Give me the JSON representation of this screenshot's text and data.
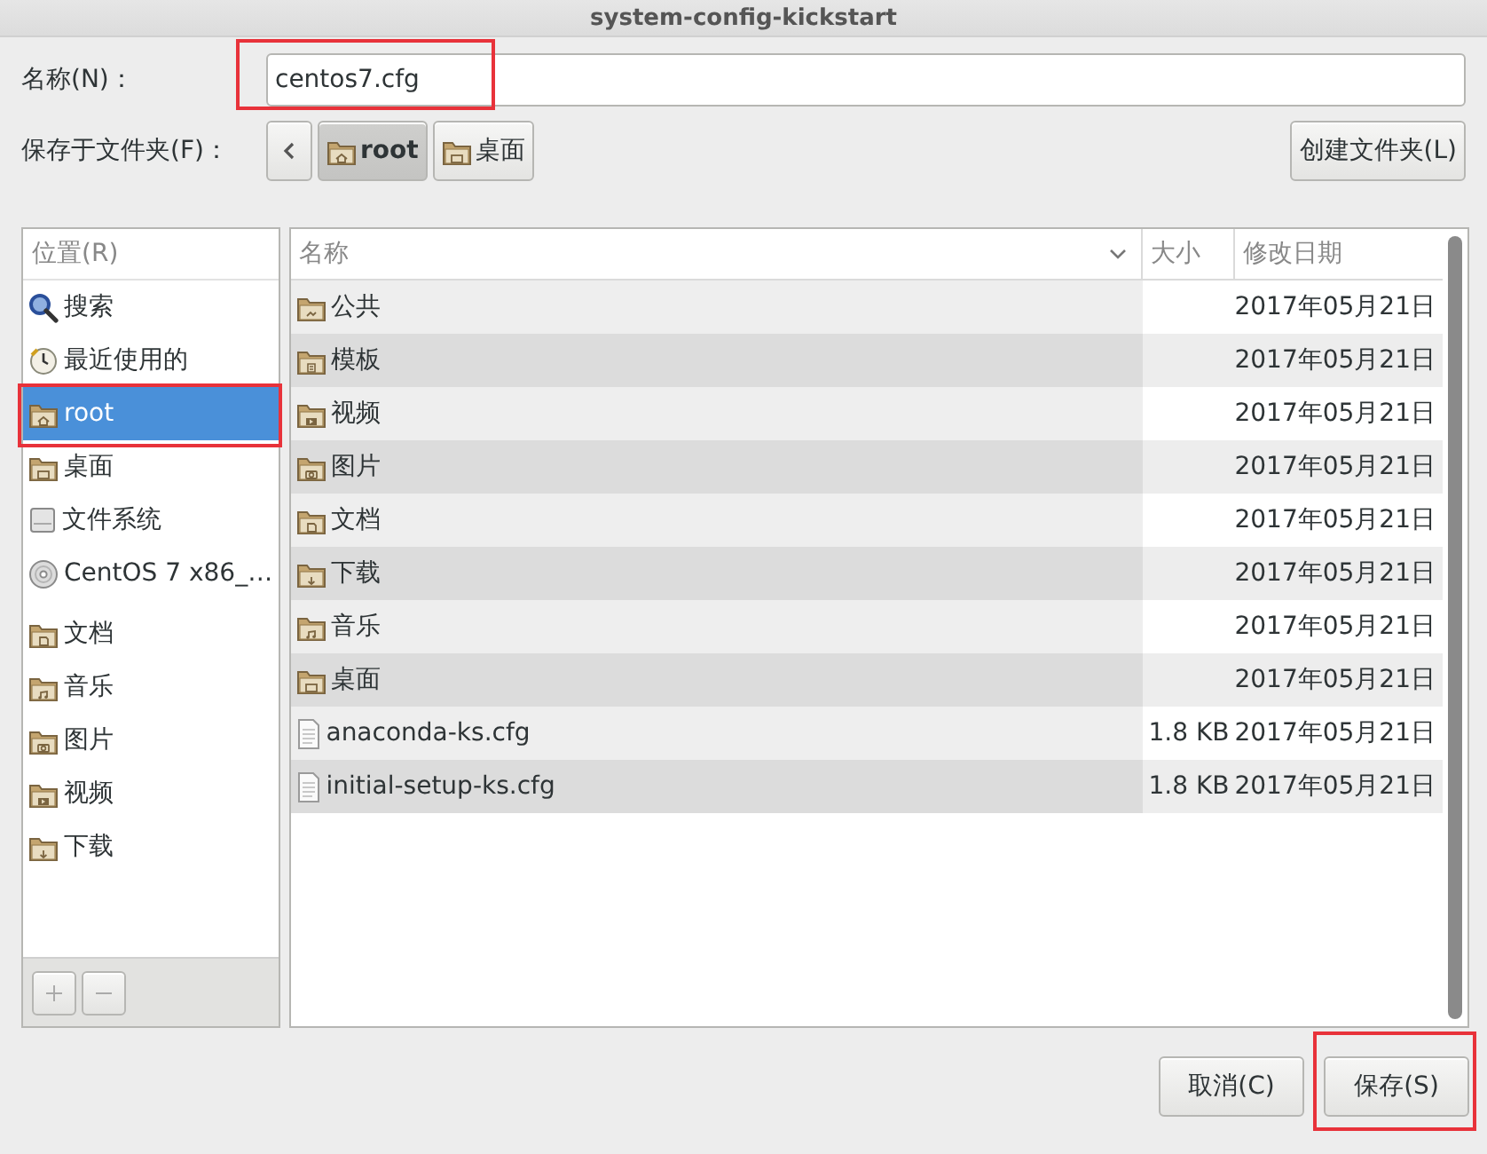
{
  "window": {
    "title": "system-config-kickstart"
  },
  "name_field": {
    "label": "名称(N)：",
    "value": "centos7.cfg",
    "highlighted": true
  },
  "folder_bar": {
    "label": "保存于文件夹(F)：",
    "path": [
      {
        "label": "root",
        "kind": "home",
        "selected": true
      },
      {
        "label": "桌面",
        "kind": "desktop",
        "selected": false
      }
    ],
    "create_button": "创建文件夹(L)"
  },
  "sidebar": {
    "heading": "位置(R)",
    "groups": [
      {
        "items": [
          {
            "label": "搜索",
            "kind": "search",
            "selected": false,
            "highlighted": false
          },
          {
            "label": "最近使用的",
            "kind": "recent",
            "selected": false,
            "highlighted": false
          },
          {
            "label": "root",
            "kind": "home",
            "selected": true,
            "highlighted": true
          },
          {
            "label": "桌面",
            "kind": "desktop",
            "selected": false,
            "highlighted": false
          },
          {
            "label": "文件系统",
            "kind": "drive",
            "selected": false,
            "highlighted": false
          },
          {
            "label": "CentOS 7 x86_…",
            "kind": "disc",
            "selected": false,
            "highlighted": false
          }
        ]
      },
      {
        "items": [
          {
            "label": "文档",
            "kind": "documents",
            "selected": false,
            "highlighted": false
          },
          {
            "label": "音乐",
            "kind": "music",
            "selected": false,
            "highlighted": false
          },
          {
            "label": "图片",
            "kind": "pictures",
            "selected": false,
            "highlighted": false
          },
          {
            "label": "视频",
            "kind": "videos",
            "selected": false,
            "highlighted": false
          },
          {
            "label": "下载",
            "kind": "downloads",
            "selected": false,
            "highlighted": false
          }
        ]
      }
    ]
  },
  "table": {
    "columns": [
      "名称",
      "大小",
      "修改日期"
    ],
    "rows": [
      {
        "name": "公共",
        "kind": "public",
        "size": "",
        "modified": "2017年05月21日"
      },
      {
        "name": "模板",
        "kind": "templates",
        "size": "",
        "modified": "2017年05月21日"
      },
      {
        "name": "视频",
        "kind": "videos",
        "size": "",
        "modified": "2017年05月21日"
      },
      {
        "name": "图片",
        "kind": "pictures",
        "size": "",
        "modified": "2017年05月21日"
      },
      {
        "name": "文档",
        "kind": "documents",
        "size": "",
        "modified": "2017年05月21日"
      },
      {
        "name": "下载",
        "kind": "downloads",
        "size": "",
        "modified": "2017年05月21日"
      },
      {
        "name": "音乐",
        "kind": "music",
        "size": "",
        "modified": "2017年05月21日"
      },
      {
        "name": "桌面",
        "kind": "desktop",
        "size": "",
        "modified": "2017年05月21日"
      },
      {
        "name": "anaconda-ks.cfg",
        "kind": "file",
        "size": "1.8 KB",
        "modified": "2017年05月21日"
      },
      {
        "name": "initial-setup-ks.cfg",
        "kind": "file",
        "size": "1.8 KB",
        "modified": "2017年05月21日"
      }
    ]
  },
  "buttons": [
    {
      "label": "取消(C)",
      "highlighted": false
    },
    {
      "label": "保存(S)",
      "highlighted": true
    }
  ]
}
